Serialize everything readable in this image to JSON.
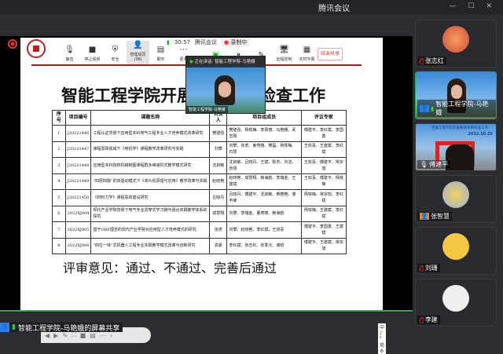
{
  "app": {
    "title": "腾讯会议"
  },
  "toolbar": {
    "timer": "30:57",
    "meeting_name": "腾讯会议",
    "recording": "录制中",
    "buttons": [
      {
        "label": "静音",
        "icon": "mic-icon"
      },
      {
        "label": "停止视频",
        "icon": "camera-icon"
      },
      {
        "label": "安全",
        "icon": "shield-icon"
      },
      {
        "label": "管理成员(36)",
        "icon": "members-icon"
      },
      {
        "label": "聊天",
        "icon": "chat-icon"
      },
      {
        "label": "更多",
        "icon": "more-icon"
      }
    ],
    "share_buttons": [
      {
        "label": "",
        "icon": "share-screen-icon"
      },
      {
        "label": "",
        "icon": "pause-icon"
      },
      {
        "label": "",
        "icon": "annotate-icon"
      },
      {
        "label": "远程控制",
        "icon": "remote-control-icon"
      },
      {
        "label": "实时字幕",
        "icon": "caption-icon"
      }
    ],
    "end_share": "结束共享"
  },
  "speaker_popup": {
    "speaking": "正在讲话: 智能工程学院-马艳娥",
    "name": "智能工程学院-马艳娥"
  },
  "slide": {
    "title": "智能工程学院开展教改项目检查工作",
    "headers": [
      "序号",
      "项目编号",
      "课题名称",
      "负责人",
      "项目组成员",
      "评议专家"
    ],
    "rows": [
      [
        "1",
        "J20221446",
        "工程认证背景下应用型本科电气工程专业人才培养模式改革研究",
        "樊建强",
        "樊建强、杨铁梅、李佩丽、马艳娥、武志刚",
        "傅建平、李红斌、李国勇"
      ],
      [
        "2",
        "J20221447",
        "课程思政视域下《电机学》课程教学改革研究与实践",
        "刘攀",
        "刘攀、张虎、姜燕丽、樊磊、杨铁梅、石慧",
        "王双喜、王建斌、李红斌"
      ],
      [
        "3",
        "J20221448",
        "应用型本科院校机械制图课程群多维递阶式教学模式研究",
        "沈启敏",
        "沈启敏、吕晓丹、王斌、陈杰、刘洁、张强",
        "王双喜、傅建平、常宗旭"
      ],
      [
        "4",
        "J20221449",
        "“四层四融”的双驱动模式下《单片机原理与应用》教学改革与实践",
        "赵晓艳",
        "赵晓艳、成慧翔、韩海韵、李瑞金、王建斌",
        "王双喜、傅建平、杨铁梅"
      ],
      [
        "5",
        "J20221450",
        "《材料力学》课程思政建设研究",
        "吕晓丹",
        "吕晓丹、傅建平、沈启敏、黄春艳、谢丰峰",
        "杨铁梅、常宗旭、李红斌"
      ],
      [
        "6",
        "2022XJ004",
        "现代产业学院背景下电气专业贯穿式学习链与混合实践教学体系的探究",
        "成慧翔",
        "刘攀、李瑞金、董燕丽、韩海韵",
        "杨铁梅、王建斌、李红斌"
      ],
      [
        "7",
        "2022XJ005",
        "基于OBE理念的现代产业学院对应用型人才培养模式的研究",
        "张虎",
        "刘攀、赵晓艳、李红斌、王双喜",
        "傅建平、李国勇、王建斌"
      ],
      [
        "8",
        "2022XJ006",
        "“四位一体”式机器人工程专业实践教学模式改革与创新研究",
        "袁晨",
        "李红斌、张志红、张季元、谢昭",
        "傅建平、王建斌、常宗旭"
      ]
    ],
    "review": "评审意见：通过、不通过、完善后通过",
    "ime": "中 ♪ ⁵ 简 ⚙"
  },
  "bottom": {
    "sharing_label": "智能工程学院-马艳娥的屏幕共享"
  },
  "participants": [
    {
      "name": "张志红",
      "muted": true
    },
    {
      "name": "智能工程学院-马艳娥",
      "muted": false
    },
    {
      "name": "傅建平",
      "muted": false,
      "caption": "智能工程学院开展教改项目检查工作",
      "date": "2022.10.26"
    },
    {
      "name": "张智慧",
      "muted": false
    },
    {
      "name": "刘珊",
      "muted": true
    },
    {
      "name": "李建",
      "muted": true
    }
  ]
}
